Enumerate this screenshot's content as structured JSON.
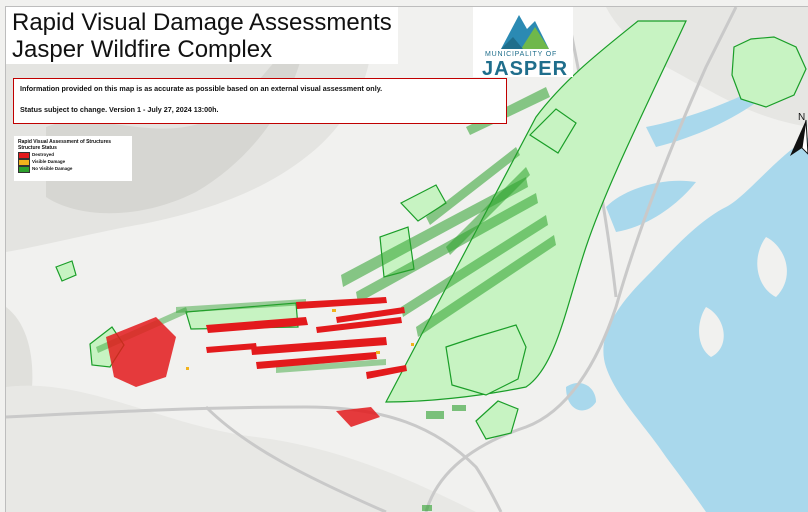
{
  "map": {
    "title_lines": [
      "Rapid Visual Damage Assessments",
      "Jasper Wildfire Complex"
    ],
    "logo": {
      "small_text": "MUNICIPALITY OF",
      "big_text": "JASPER",
      "colors": [
        "#2b8ab3",
        "#6fb84b",
        "#1f6e8c"
      ]
    },
    "notice": {
      "line1": "Information provided on this map is as accurate as possible based on an external visual assessment only.",
      "line2": "Status subject to change. Version 1 - July 27, 2024 13:00h.",
      "border_color": "#c00000"
    },
    "legend": {
      "title": "Rapid Visual Assessment of Structures",
      "subtitle": "Structure Status",
      "items": [
        {
          "label": "Destroyed",
          "color": "#e31a1c"
        },
        {
          "label": "Visible Damage",
          "color": "#f2b21c"
        },
        {
          "label": "No Visible Damage",
          "color": "#2ca02c"
        }
      ]
    },
    "north_arrow_label": "N",
    "colors": {
      "terrain": "#f1f1ef",
      "water": "#a9d8ec",
      "undamaged_fill": "#c7f3c2",
      "undamaged_stroke": "#1a9e28",
      "destroyed": "#e31a1c",
      "damaged": "#f2b21c"
    }
  }
}
